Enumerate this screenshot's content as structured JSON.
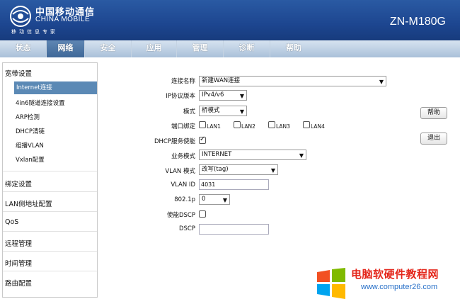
{
  "header": {
    "brand_cn": "中国移动通信",
    "brand_en": "CHINA MOBILE",
    "slogan": "移动信息专家",
    "model": "ZN-M180G"
  },
  "nav": {
    "items": [
      "状态",
      "网络",
      "安全",
      "应用",
      "管理",
      "诊断",
      "帮助"
    ],
    "active": "网络"
  },
  "sidebar": {
    "groups": [
      {
        "label": "宽带设置",
        "items": [
          "Internet连接",
          "4in6隧道连接设置",
          "ARP检测",
          "DHCP清链",
          "组播VLAN",
          "Vxlan配置"
        ],
        "active": "Internet连接"
      },
      {
        "label": "绑定设置"
      },
      {
        "label": "LAN侧地址配置"
      },
      {
        "label": "QoS"
      },
      {
        "label": "远程管理"
      },
      {
        "label": "时间管理"
      },
      {
        "label": "路由配置"
      }
    ]
  },
  "form": {
    "connection_name": {
      "label": "连接名称",
      "value": "新建WAN连接"
    },
    "ip_version": {
      "label": "IP协议版本",
      "value": "IPv4/v6"
    },
    "mode": {
      "label": "模式",
      "value": "桥模式"
    },
    "port_binding": {
      "label": "端口绑定",
      "ports": [
        "LAN1",
        "LAN2",
        "LAN3",
        "LAN4"
      ]
    },
    "dhcp_service": {
      "label": "DHCP服务使能",
      "checked": true
    },
    "service_mode": {
      "label": "业务模式",
      "value": "INTERNET"
    },
    "vlan_mode": {
      "label": "VLAN 模式",
      "value": "改写(tag)"
    },
    "vlan_id": {
      "label": "VLAN ID",
      "value": "4031"
    },
    "dot1p": {
      "label": "802.1p",
      "value": "0"
    },
    "enable_dscp": {
      "label": "使能DSCP",
      "checked": false
    },
    "dscp": {
      "label": "DSCP",
      "value": ""
    }
  },
  "buttons": {
    "help": "帮助",
    "logout": "退出"
  },
  "watermark": {
    "text": "电脑软硬件教程网",
    "url": "www.computer26.com"
  }
}
